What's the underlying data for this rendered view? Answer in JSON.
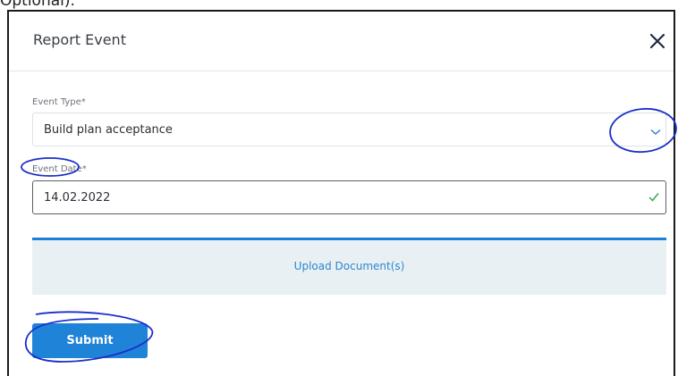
{
  "background_text": "Optional).",
  "dialog": {
    "title": "Report Event",
    "close_icon": "close-icon"
  },
  "event_type": {
    "label": "Event Type*",
    "value": "Build plan acceptance",
    "icon": "chevron-down-icon"
  },
  "event_date": {
    "label": "Event Date*",
    "value": "14.02.2022",
    "icon": "check-icon"
  },
  "upload": {
    "label": "Upload Document(s)"
  },
  "submit": {
    "label": "Submit"
  },
  "colors": {
    "accent": "#1f83d8",
    "upload_bg": "#e9f0f3",
    "annotation": "#1a2fc9"
  }
}
